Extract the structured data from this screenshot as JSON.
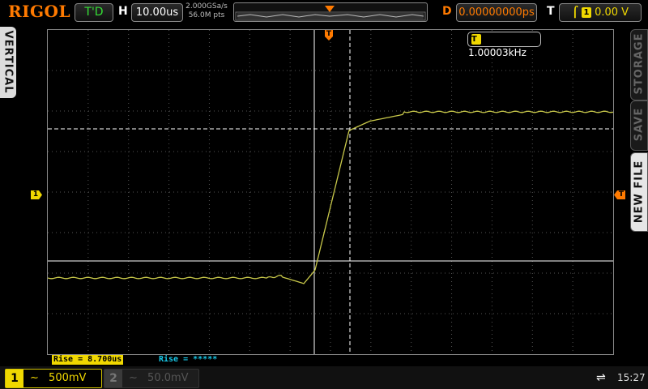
{
  "brand": "RIGOL",
  "top": {
    "run_state": "T'D",
    "h_label": "H",
    "timebase": "10.00us",
    "sample_rate": "2.000GSa/s",
    "mem_depth": "56.0M pts",
    "d_label": "D",
    "delay": "0.00000000ps",
    "t_label": "T",
    "trigger_level": "0.00 V",
    "trigger_edge_icon": "rising-edge-icon",
    "trigger_source": "1"
  },
  "side_tabs": {
    "vertical": "VERTICAL",
    "storage": "STORAGE",
    "save": "SAVE",
    "new_file": "NEW FILE"
  },
  "counter": {
    "badge": "T",
    "value": "1.00003kHz"
  },
  "measurements": {
    "rise_ch1": "Rise = 8.700us",
    "rise_ch2": "Rise = *****"
  },
  "channels": [
    {
      "num": "1",
      "coupling_icon": "ac-coupling-icon",
      "scale": "500mV",
      "color": "#f0d800"
    },
    {
      "num": "2",
      "coupling_icon": "ac-coupling-icon",
      "scale": "50.0mV",
      "color": "#555555"
    }
  ],
  "status": {
    "time": "15:27",
    "usb_icon": "usb-icon"
  },
  "markers": {
    "ch1_level": "1",
    "trigger_pos": "T",
    "trigger_level": "T"
  },
  "colors": {
    "trace": "#c8c84a",
    "accent": "#ff7a00",
    "grid": "#555555"
  }
}
